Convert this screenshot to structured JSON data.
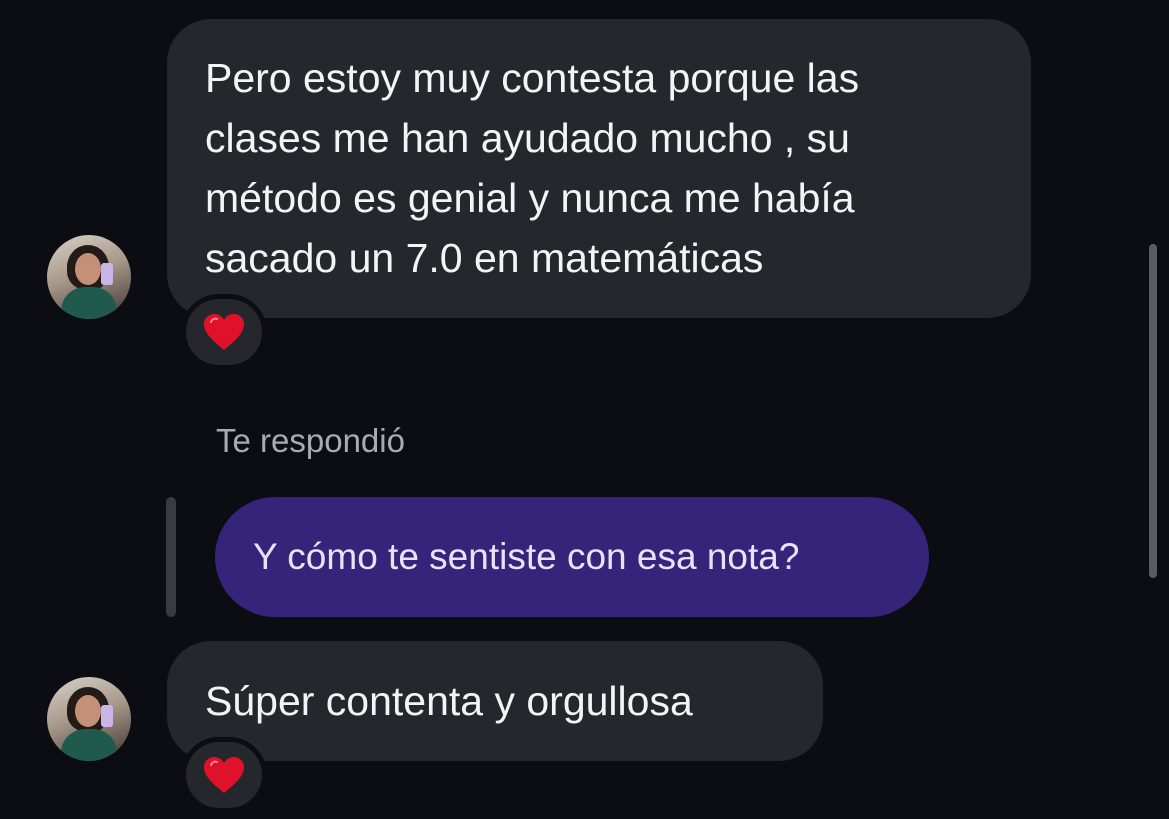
{
  "messages": {
    "first": {
      "text_lines": [
        "Pero estoy muy contesta porque las",
        "clases me han ayudado mucho , su",
        "método es genial y nunca me había",
        "sacado un 7.0 en matemáticas"
      ],
      "reaction": "heart"
    },
    "reply_label": "Te respondió",
    "reply": {
      "text": "Y cómo te sentiste con esa nota?"
    },
    "second": {
      "text": "Súper contenta y orgullosa",
      "reaction": "heart"
    }
  },
  "colors": {
    "background": "#0c0d12",
    "incoming_bubble": "#26272c",
    "outgoing_bubble": "#36237a",
    "heart": "#e0112b"
  },
  "icons": {
    "reaction": "red-heart-icon",
    "avatar": "user-avatar"
  }
}
